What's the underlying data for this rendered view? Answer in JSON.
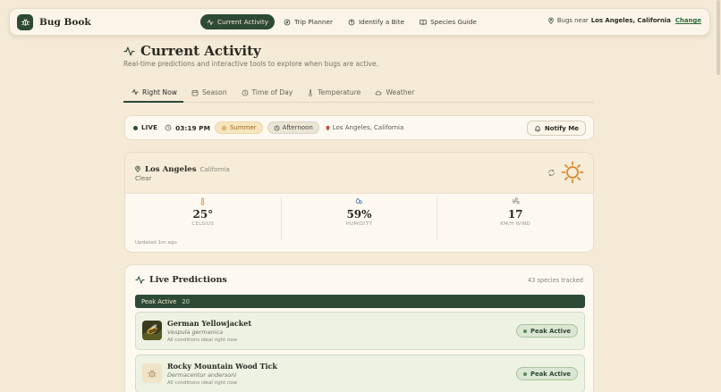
{
  "brand": {
    "name": "Bug Book",
    "icon": "bug-icon"
  },
  "nav": {
    "links": [
      {
        "label": "Current Activity",
        "icon": "activity-icon",
        "active": true
      },
      {
        "label": "Trip Planner",
        "icon": "compass-icon",
        "active": false
      },
      {
        "label": "Identify a Bite",
        "icon": "help-circle-icon",
        "active": false
      },
      {
        "label": "Species Guide",
        "icon": "book-icon",
        "active": false
      }
    ],
    "location_prefix": "Bugs near",
    "location": "Los Angeles, California",
    "change_label": "Change"
  },
  "page": {
    "title": "Current Activity",
    "subtitle": "Real-time predictions and interactive tools to explore when bugs are active."
  },
  "tabs": [
    {
      "label": "Right Now",
      "icon": "activity-icon",
      "active": true
    },
    {
      "label": "Season",
      "icon": "calendar-icon",
      "active": false
    },
    {
      "label": "Time of Day",
      "icon": "clock-icon",
      "active": false
    },
    {
      "label": "Temperature",
      "icon": "thermometer-icon",
      "active": false
    },
    {
      "label": "Weather",
      "icon": "cloud-icon",
      "active": false
    }
  ],
  "live": {
    "label": "LIVE",
    "time": "03:19 PM",
    "season": "Summer",
    "period": "Afternoon",
    "location": "Los Angeles, California",
    "notify_label": "Notify Me"
  },
  "weather": {
    "city": "Los Angeles",
    "state": "California",
    "condition": "Clear",
    "stats": [
      {
        "value": "25°",
        "label": "CELSIUS",
        "icon": "thermometer-icon"
      },
      {
        "value": "59%",
        "label": "HUMIDITY",
        "icon": "droplets-icon"
      },
      {
        "value": "17",
        "label": "KM/H WIND",
        "icon": "wind-icon"
      }
    ],
    "updated": "Updated 1m ago"
  },
  "predictions": {
    "title": "Live Predictions",
    "tracked": "43 species tracked",
    "group_label": "Peak Active",
    "group_count": "20",
    "species": [
      {
        "name": "German Yellowjacket",
        "scientific": "Vespula germanica",
        "note": "All conditions ideal right now",
        "status": "Peak Active"
      },
      {
        "name": "Rocky Mountain Wood Tick",
        "scientific": "Dermacentor andersoni",
        "note": "All conditions ideal right now",
        "status": "Peak Active"
      }
    ]
  },
  "colors": {
    "background": "#f4ead6",
    "accent": "#2d4a35",
    "sun": "#d98a2b",
    "card": "#fdf9f1"
  }
}
